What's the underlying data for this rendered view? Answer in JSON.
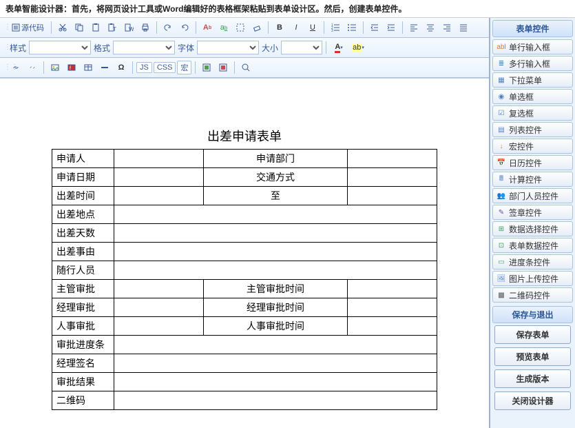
{
  "header": {
    "text": "表单智能设计器：首先，将网页设计工具或Word编辑好的表格框架粘贴到表单设计区。然后，创建表单控件。"
  },
  "source_btn": "源代码",
  "labels": {
    "style": "样式",
    "format": "格式",
    "font": "字体",
    "size": "大小"
  },
  "tbtext": {
    "js": "JS",
    "css": "CSS",
    "macro": "宏"
  },
  "form": {
    "title": "出差申请表单",
    "rows": {
      "r1a": "申请人",
      "r1b": "申请部门",
      "r2a": "申请日期",
      "r2b": "交通方式",
      "r3a": "出差时间",
      "r3b": "至",
      "r4": "出差地点",
      "r5": "出差天数",
      "r6": "出差事由",
      "r7": "随行人员",
      "r8a": "主管审批",
      "r8b": "主管审批时间",
      "r9a": "经理审批",
      "r9b": "经理审批时间",
      "r10a": "人事审批",
      "r10b": "人事审批时间",
      "r11": "审批进度条",
      "r12": "经理签名",
      "r13": "审批结果",
      "r14": "二维码"
    }
  },
  "panels": {
    "controls": "表单控件",
    "save": "保存与退出"
  },
  "controls": [
    {
      "icon": "abl",
      "label": "单行输入框",
      "color": "#d08030"
    },
    {
      "icon": "≣",
      "label": "多行输入框",
      "color": "#5080c0"
    },
    {
      "icon": "▦",
      "label": "下拉菜单",
      "color": "#5080c0"
    },
    {
      "icon": "◉",
      "label": "单选框",
      "color": "#5080c0"
    },
    {
      "icon": "☑",
      "label": "复选框",
      "color": "#5080c0"
    },
    {
      "icon": "▤",
      "label": "列表控件",
      "color": "#5080c0"
    },
    {
      "icon": "↓",
      "label": "宏控件",
      "color": "#d08030"
    },
    {
      "icon": "📅",
      "label": "日历控件",
      "color": "#d04040"
    },
    {
      "icon": "🖩",
      "label": "计算控件",
      "color": "#5080c0"
    },
    {
      "icon": "👥",
      "label": "部门人员控件",
      "color": "#5080c0"
    },
    {
      "icon": "✎",
      "label": "签章控件",
      "color": "#7050a0"
    },
    {
      "icon": "⊞",
      "label": "数据选择控件",
      "color": "#40a060"
    },
    {
      "icon": "⊡",
      "label": "表单数据控件",
      "color": "#40a060"
    },
    {
      "icon": "▭",
      "label": "进度条控件",
      "color": "#40a060"
    },
    {
      "icon": "🖼",
      "label": "图片上传控件",
      "color": "#5080c0"
    },
    {
      "icon": "▩",
      "label": "二维码控件",
      "color": "#555"
    }
  ],
  "actions": [
    {
      "label": "保存表单"
    },
    {
      "label": "预览表单"
    },
    {
      "label": "生成版本"
    },
    {
      "label": "关闭设计器"
    }
  ]
}
